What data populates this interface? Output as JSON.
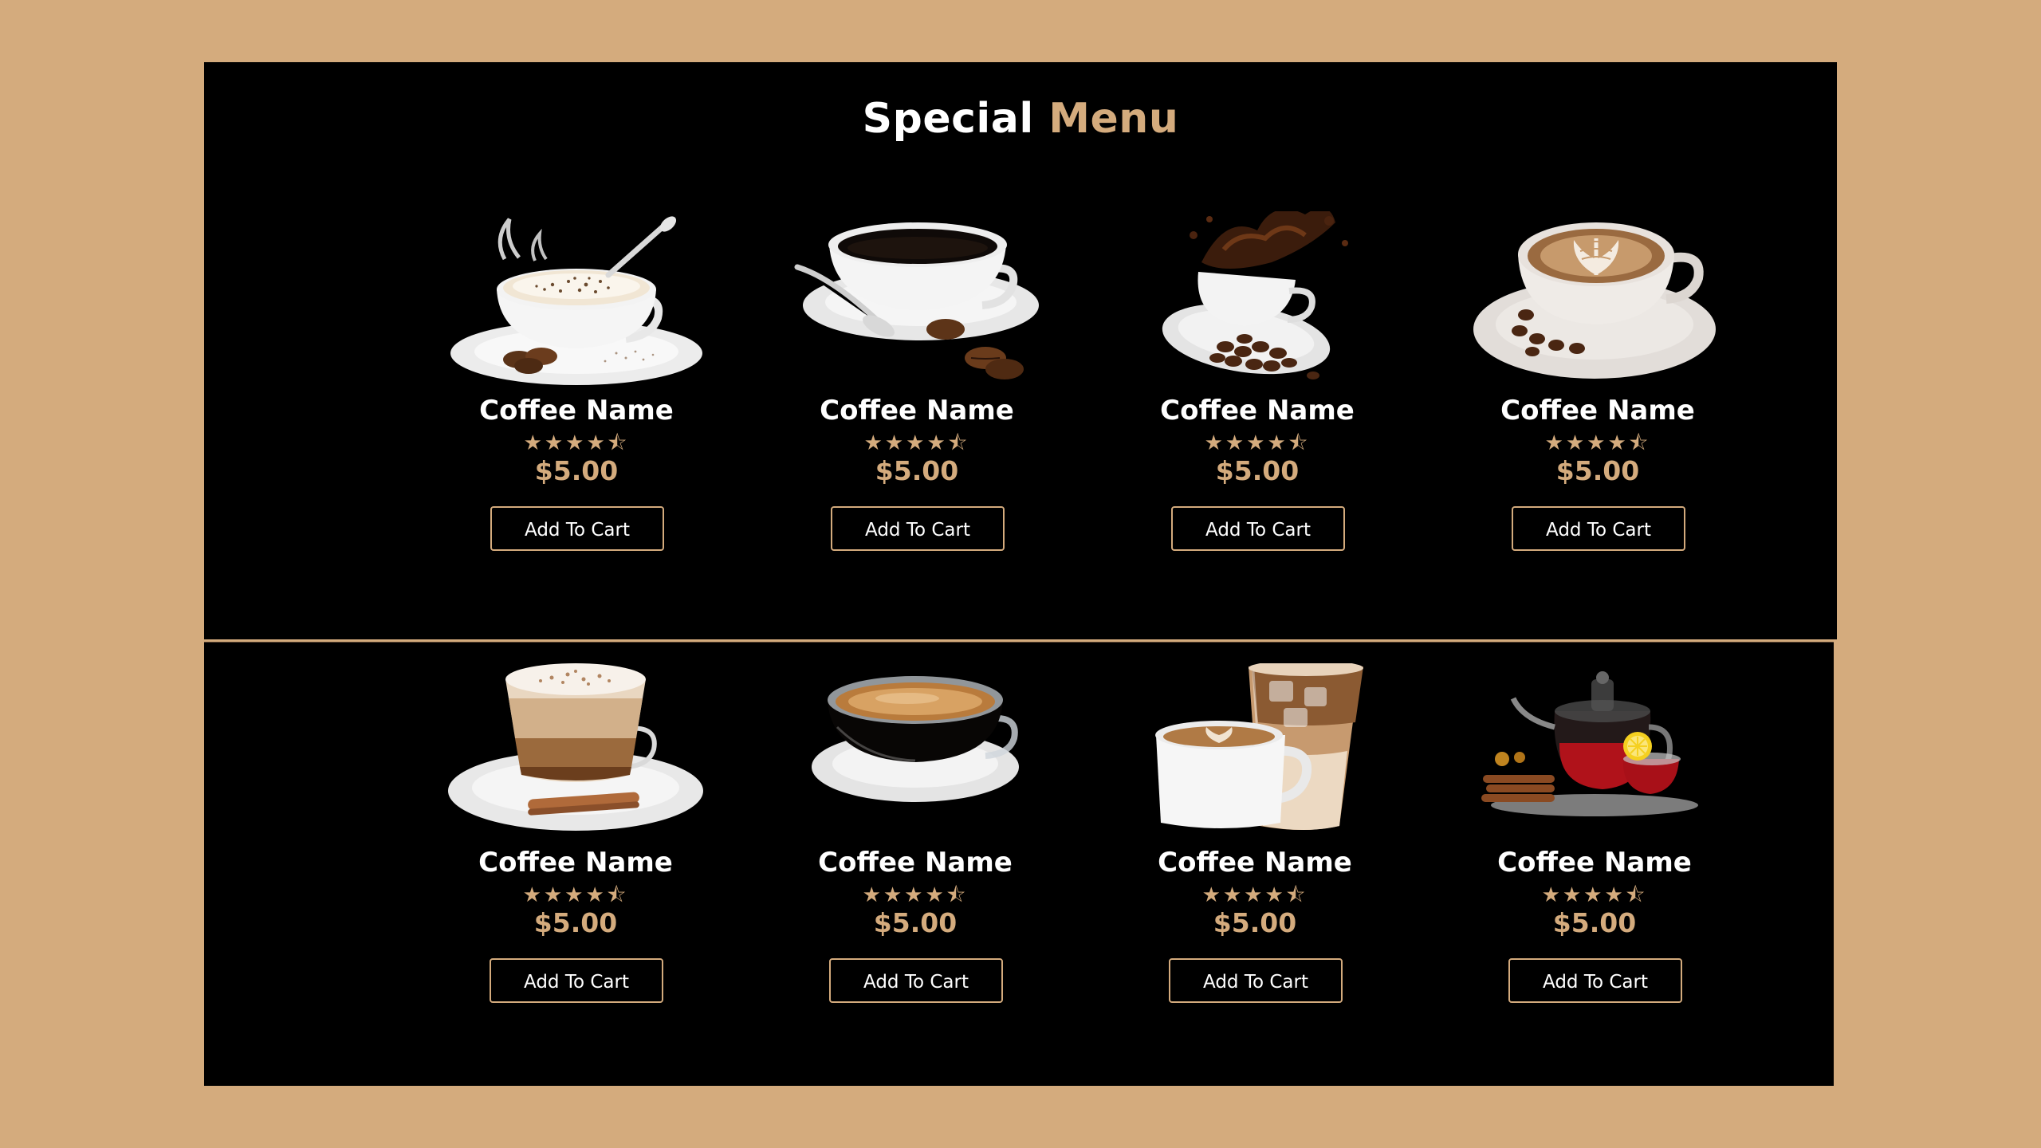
{
  "menu": {
    "title_part1": "Special",
    "title_part2": "Menu"
  },
  "colors": {
    "accent": "#d4ab7d",
    "panel": "#000000",
    "text": "#ffffff"
  },
  "rating_display": "★★★★⯪",
  "items": [
    {
      "name": "Coffee Name",
      "price": "$5.00",
      "rating": 4.5,
      "button": "Add To Cart",
      "image": "cappuccino-cup-icon"
    },
    {
      "name": "Coffee Name",
      "price": "$5.00",
      "rating": 4.5,
      "button": "Add To Cart",
      "image": "black-coffee-cup-icon"
    },
    {
      "name": "Coffee Name",
      "price": "$5.00",
      "rating": 4.5,
      "button": "Add To Cart",
      "image": "coffee-splash-cup-icon"
    },
    {
      "name": "Coffee Name",
      "price": "$5.00",
      "rating": 4.5,
      "button": "Add To Cart",
      "image": "latte-art-cup-icon"
    },
    {
      "name": "Coffee Name",
      "price": "$5.00",
      "rating": 4.5,
      "button": "Add To Cart",
      "image": "layered-latte-glass-icon"
    },
    {
      "name": "Coffee Name",
      "price": "$5.00",
      "rating": 4.5,
      "button": "Add To Cart",
      "image": "espresso-glass-cup-icon"
    },
    {
      "name": "Coffee Name",
      "price": "$5.00",
      "rating": 4.5,
      "button": "Add To Cart",
      "image": "iced-coffee-duo-icon"
    },
    {
      "name": "Coffee Name",
      "price": "$5.00",
      "rating": 4.5,
      "button": "Add To Cart",
      "image": "tea-pot-icon"
    }
  ]
}
